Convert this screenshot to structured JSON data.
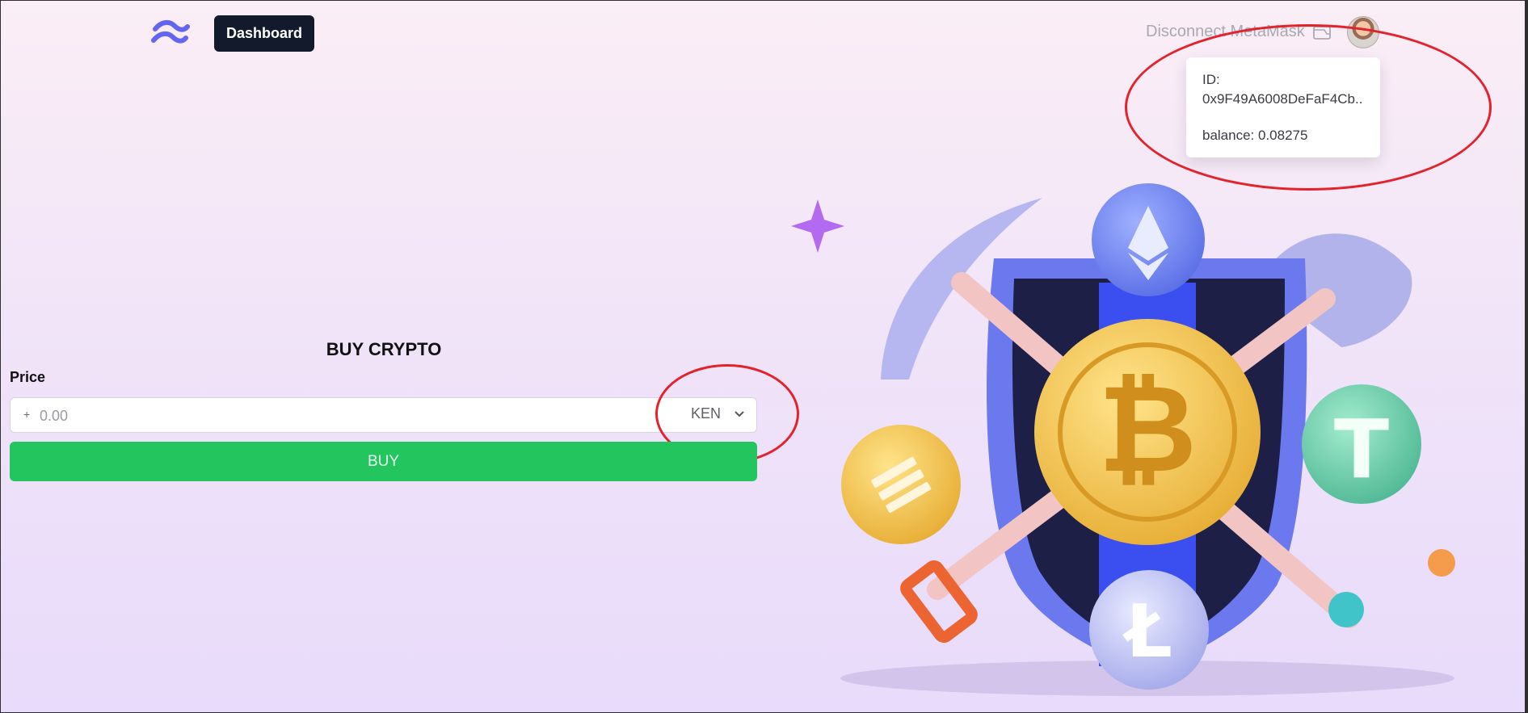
{
  "header": {
    "dashboard_label": "Dashboard",
    "disconnect_label": "Disconnect MetaMask"
  },
  "account_popover": {
    "id_label": "ID:",
    "id_value": "0x9F49A6008DeFaF4Cb...",
    "balance_text": "balance: 0.08275"
  },
  "buy_form": {
    "title": "BUY CRYPTO",
    "price_label": "Price",
    "price_prefix": "+",
    "price_placeholder": "0.00",
    "currency": "KEN",
    "buy_label": "BUY"
  },
  "illustration": {
    "coins": [
      "ethereum-coin",
      "bitcoin-coin",
      "tether-coin",
      "binance-coin",
      "litecoin-coin"
    ]
  },
  "colors": {
    "dashboard_bg": "#131a2b",
    "buy_button": "#22c55e",
    "highlight_ring": "#e3222b",
    "logo": "#6366f1"
  }
}
